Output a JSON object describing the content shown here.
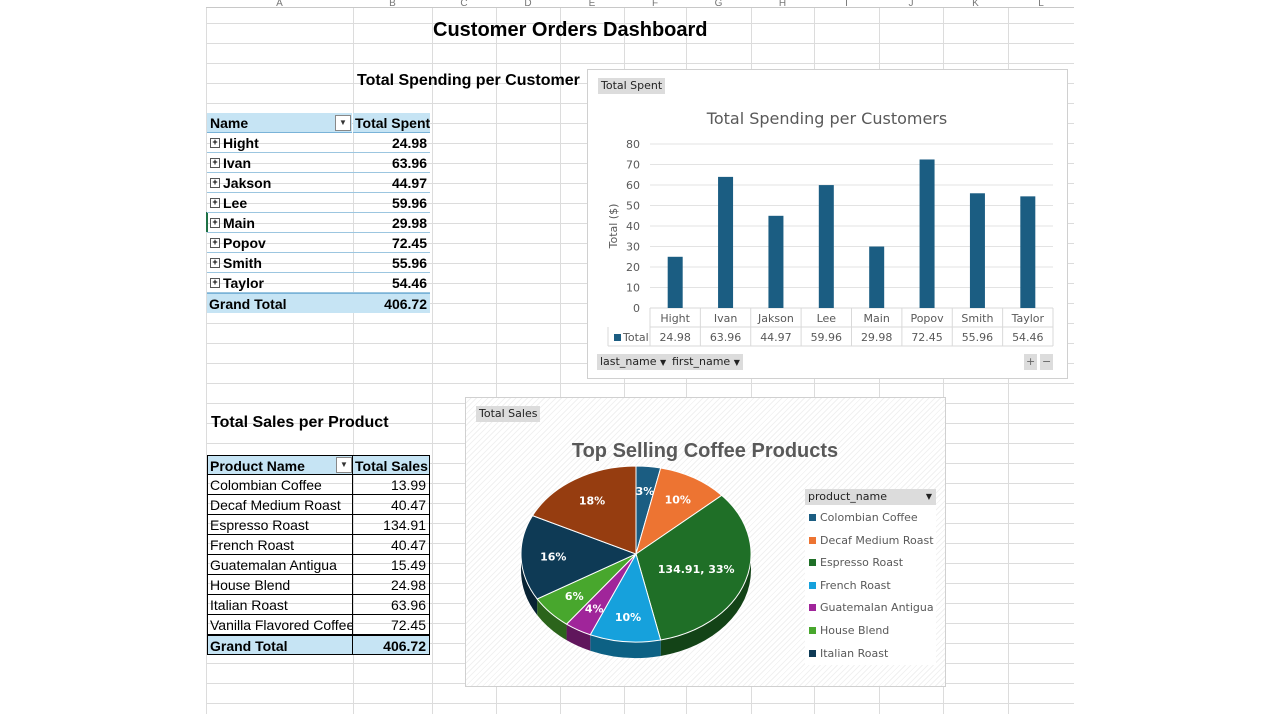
{
  "columns": [
    "A",
    "B",
    "C",
    "D",
    "E",
    "F",
    "G",
    "H",
    "I",
    "J",
    "K",
    "L"
  ],
  "dashboard_title": "Customer Orders Dashboard",
  "spending_section_title": "Total Spending per Customer",
  "sales_section_title": "Total Sales per Product",
  "customer_pivot": {
    "header_name": "Name",
    "header_value": "Total Spent",
    "rows": [
      {
        "name": "Hight",
        "value": "24.98"
      },
      {
        "name": "Ivan",
        "value": "63.96"
      },
      {
        "name": "Jakson",
        "value": "44.97"
      },
      {
        "name": "Lee",
        "value": "59.96"
      },
      {
        "name": "Main",
        "value": "29.98"
      },
      {
        "name": "Popov",
        "value": "72.45"
      },
      {
        "name": "Smith",
        "value": "55.96"
      },
      {
        "name": "Taylor",
        "value": "54.46"
      }
    ],
    "grand_total_label": "Grand Total",
    "grand_total_value": "406.72",
    "expand_symbol": "+"
  },
  "product_pivot": {
    "header_name": "Product Name",
    "header_value": "Total Sales",
    "rows": [
      {
        "name": "Colombian Coffee",
        "value": "13.99"
      },
      {
        "name": "Decaf Medium Roast",
        "value": "40.47"
      },
      {
        "name": "Espresso Roast",
        "value": "134.91"
      },
      {
        "name": "French Roast",
        "value": "40.47"
      },
      {
        "name": "Guatemalan Antigua",
        "value": "15.49"
      },
      {
        "name": "House Blend",
        "value": "24.98"
      },
      {
        "name": "Italian Roast",
        "value": "63.96"
      },
      {
        "name": "Vanilla Flavored Coffee",
        "value": "72.45"
      }
    ],
    "grand_total_label": "Grand Total",
    "grand_total_value": "406.72"
  },
  "bar_chart_ui": {
    "field_button": "Total Spent",
    "axis_buttons": [
      "last_name",
      "first_name"
    ],
    "zoom_in": "+",
    "zoom_out": "−",
    "dropdown_glyph": "▼"
  },
  "pie_chart_ui": {
    "field_button": "Total Sales",
    "legend_field": "product_name",
    "dropdown_glyph": "▼"
  },
  "chart_data": [
    {
      "type": "bar",
      "title": "Total Spending per Customers",
      "ylabel": "Total ($)",
      "xlabel": "",
      "categories": [
        "Hight",
        "Ivan",
        "Jakson",
        "Lee",
        "Main",
        "Popov",
        "Smith",
        "Taylor"
      ],
      "series": [
        {
          "name": "Total",
          "values": [
            24.98,
            63.96,
            44.97,
            59.96,
            29.98,
            72.45,
            55.96,
            54.46
          ]
        }
      ],
      "data_table": [
        "24.98",
        "63.96",
        "44.97",
        "59.96",
        "29.98",
        "72.45",
        "55.96",
        "54.46"
      ],
      "ylim": [
        0,
        80
      ],
      "yticks": [
        "0",
        "10",
        "20",
        "30",
        "40",
        "50",
        "60",
        "70",
        "80"
      ],
      "grid": true,
      "color": "#1b5d82"
    },
    {
      "type": "pie",
      "title": "Top Selling Coffee Products",
      "categories": [
        "Colombian Coffee",
        "Decaf Medium Roast",
        "Espresso Roast",
        "French Roast",
        "Guatemalan Antigua",
        "House Blend",
        "Italian Roast",
        "Vanilla Flavored Coffee"
      ],
      "values": [
        13.99,
        40.47,
        134.91,
        40.47,
        15.49,
        24.98,
        63.96,
        72.45
      ],
      "labels": [
        "3%",
        "10%",
        "134.91, 33%",
        "10%",
        "4%",
        "6%",
        "16%",
        "18%"
      ],
      "legend_visible": [
        "Colombian Coffee",
        "Decaf Medium Roast",
        "Espresso Roast",
        "French Roast",
        "Guatemalan Antigua",
        "House Blend",
        "Italian Roast"
      ],
      "legend_position": "right",
      "colors": [
        "#1b5d82",
        "#ed7432",
        "#1f6f27",
        "#16a1dc",
        "#a0259a",
        "#48a72d",
        "#0e3a55",
        "#963d10"
      ]
    }
  ]
}
